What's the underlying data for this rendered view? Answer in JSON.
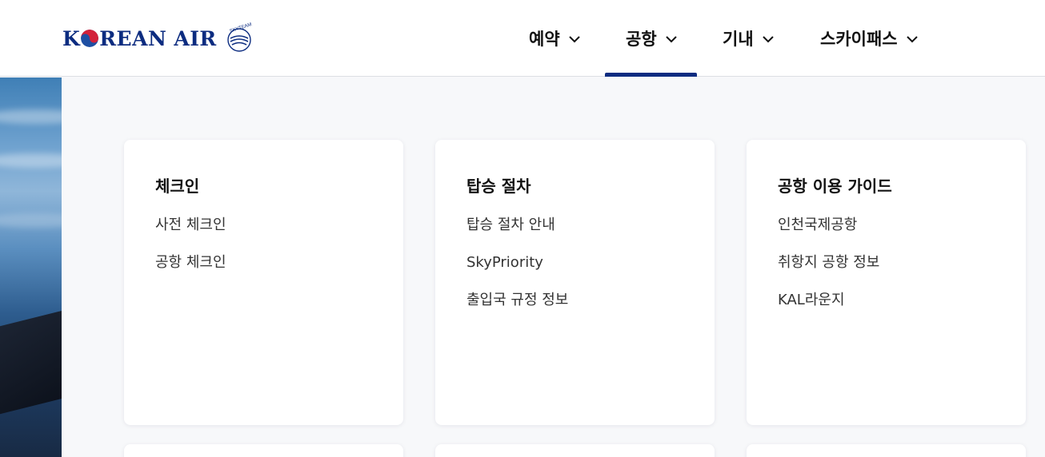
{
  "header": {
    "logo_text": "KOREAN AIR",
    "skyteam_text": "SKYTEAM",
    "nav": [
      {
        "label": "예약"
      },
      {
        "label": "공항",
        "active": true
      },
      {
        "label": "기내"
      },
      {
        "label": "스카이패스"
      }
    ]
  },
  "cards": [
    {
      "title": "체크인",
      "links": [
        "사전 체크인",
        "공항 체크인"
      ]
    },
    {
      "title": "탑승 절차",
      "links": [
        "탑승 절차 안내",
        "SkyPriority",
        "출입국 규정 정보"
      ]
    },
    {
      "title": "공항 이용 가이드",
      "links": [
        "인천국제공항",
        "취항지 공항 정보",
        "KAL라운지"
      ]
    }
  ],
  "colors": {
    "brand": "#0c2c80",
    "page_bg": "#f7f8fa",
    "card_bg": "#ffffff",
    "taeguk_red": "#d3213a",
    "taeguk_blue": "#1e4fa3"
  },
  "icons": {
    "nav_dropdown": "chevron-down-icon"
  }
}
